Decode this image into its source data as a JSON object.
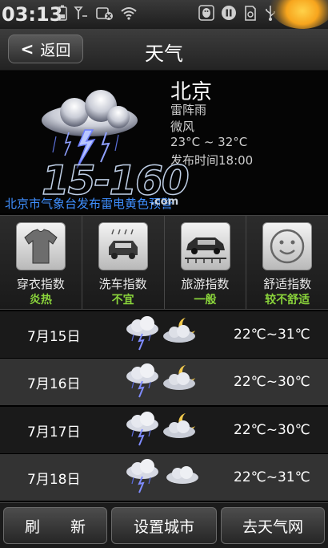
{
  "status_bar": {
    "time": "03:13",
    "icons": [
      "battery-icon",
      "signal-icon",
      "no-sim-icon",
      "wifi-icon",
      "qq-icon",
      "pause-icon",
      "sd-card-icon",
      "usb-icon",
      "sun-glow-icon"
    ]
  },
  "header": {
    "back_label": "返回",
    "title": "天气"
  },
  "current": {
    "city": "北京",
    "condition": "雷阵雨",
    "wind": "微风",
    "temp_range": "23°C ~ 32°C",
    "publish_time": "发布时间18:00",
    "icon": "thunderstorm-cloud-icon"
  },
  "alert": "北京市气象台发布雷电黄色预警",
  "watermark": {
    "main": "15-160",
    "suffix": ".com"
  },
  "indices": [
    {
      "name": "穿衣指数",
      "value": "炎热",
      "icon": "tshirt-icon"
    },
    {
      "name": "洗车指数",
      "value": "不宜",
      "icon": "car-wash-icon"
    },
    {
      "name": "旅游指数",
      "value": "一般",
      "icon": "car-travel-icon"
    },
    {
      "name": "舒适指数",
      "value": "较不舒适",
      "icon": "smiley-icon"
    }
  ],
  "forecast": [
    {
      "date": "7月15日",
      "temp": "22℃~31℃",
      "day_icon": "thunderstorm-icon",
      "night_icon": "moon-cloud-icon"
    },
    {
      "date": "7月16日",
      "temp": "22℃~30℃",
      "day_icon": "thunderstorm-icon",
      "night_icon": "moon-cloud-icon"
    },
    {
      "date": "7月17日",
      "temp": "22℃~30℃",
      "day_icon": "thunderstorm-icon",
      "night_icon": "moon-cloud-icon"
    },
    {
      "date": "7月18日",
      "temp": "22℃~31℃",
      "day_icon": "thunderstorm-icon",
      "night_icon": "cloud-icon"
    }
  ],
  "bottom_buttons": {
    "refresh": "刷　　新",
    "set_city": "设置城市",
    "go_site": "去天气网"
  },
  "colors": {
    "accent_green": "#8ad43b",
    "alert_blue": "#3f8fff"
  }
}
